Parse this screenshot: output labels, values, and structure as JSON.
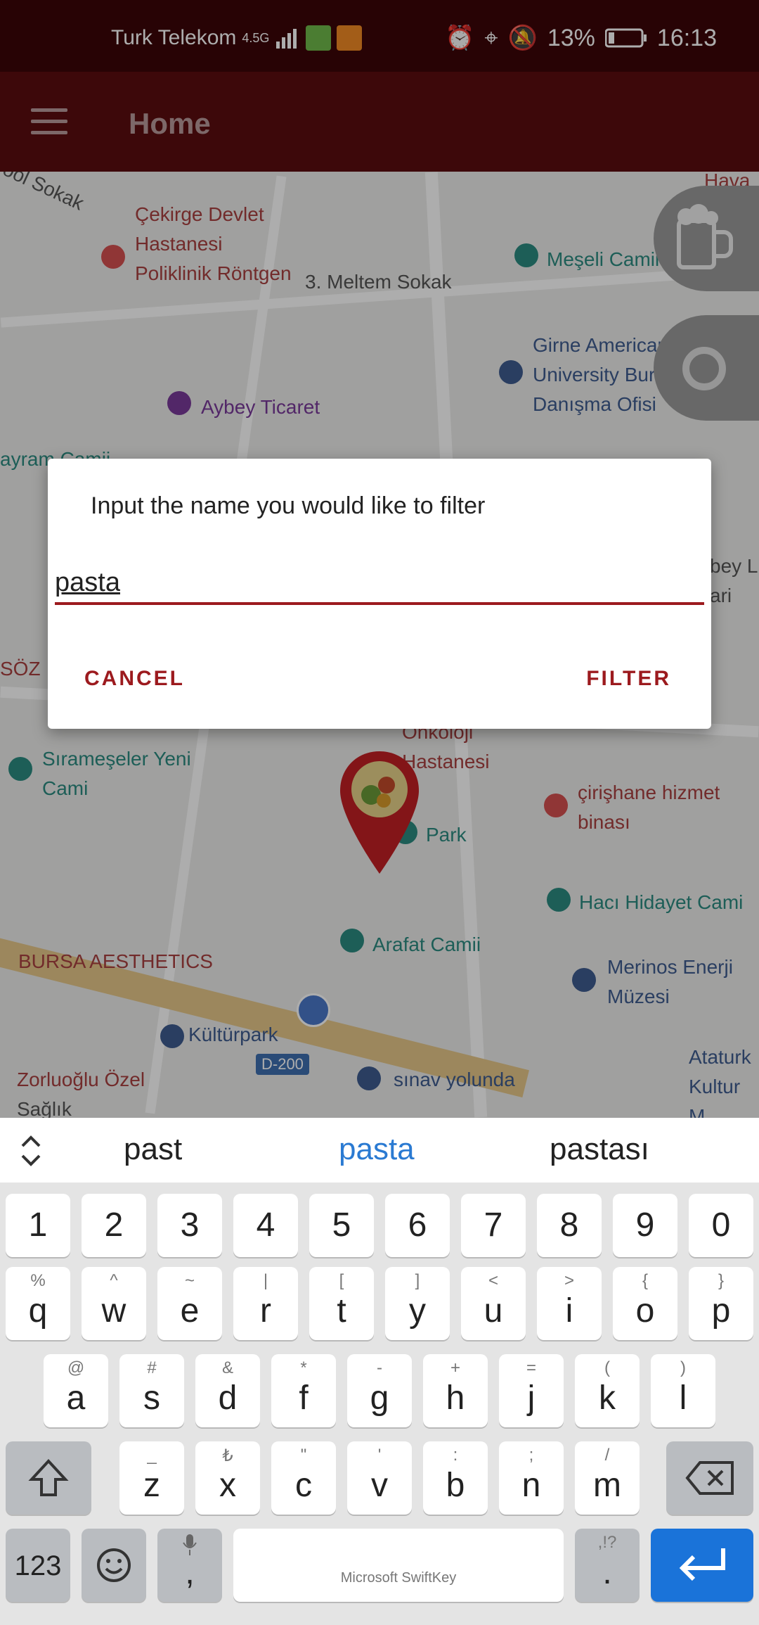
{
  "status_bar": {
    "carrier": "Turk Telekom",
    "network": "4.5G",
    "battery": "13%",
    "time": "16:13"
  },
  "app_bar": {
    "title": "Home"
  },
  "map": {
    "labels": [
      "Çekirge Devlet Hastanesi Poliklinik Röntgen",
      "3. Meltem Sokak",
      "Meşeli Camii",
      "Girne American University Bursa Danışma Ofisi",
      "Aybey Ticaret",
      "Sırameşeler Yeni Cami",
      "Onkoloji Hastanesi",
      "Park",
      "çirişhane hizmet binası",
      "Hacı Hidayet Cami",
      "Arafat Camii",
      "BURSA AESTHETICS",
      "Merinos Enerji Müzesi",
      "Kültürpark",
      "D-200",
      "Zorluoğlu Özel",
      "sınav yolunda",
      "Ataturk Kultur M",
      "Hava",
      "ool Sokak",
      "ayram Camii",
      "SÖZ",
      "bey L ari",
      "Sağlık"
    ]
  },
  "dialog": {
    "title": "Input the name you would like to filter",
    "input_value": "pasta",
    "cancel_label": "CANCEL",
    "filter_label": "FILTER"
  },
  "keyboard": {
    "suggestions": [
      "past",
      "pasta",
      "pastası"
    ],
    "row_numbers": [
      "1",
      "2",
      "3",
      "4",
      "5",
      "6",
      "7",
      "8",
      "9",
      "0"
    ],
    "row1": [
      {
        "main": "q",
        "sec": "%"
      },
      {
        "main": "w",
        "sec": "^"
      },
      {
        "main": "e",
        "sec": "~"
      },
      {
        "main": "r",
        "sec": "|"
      },
      {
        "main": "t",
        "sec": "["
      },
      {
        "main": "y",
        "sec": "]"
      },
      {
        "main": "u",
        "sec": "<"
      },
      {
        "main": "i",
        "sec": ">"
      },
      {
        "main": "o",
        "sec": "{"
      },
      {
        "main": "p",
        "sec": "}"
      }
    ],
    "row2": [
      {
        "main": "a",
        "sec": "@"
      },
      {
        "main": "s",
        "sec": "#"
      },
      {
        "main": "d",
        "sec": "&"
      },
      {
        "main": "f",
        "sec": "*"
      },
      {
        "main": "g",
        "sec": "-"
      },
      {
        "main": "h",
        "sec": "+"
      },
      {
        "main": "j",
        "sec": "="
      },
      {
        "main": "k",
        "sec": "("
      },
      {
        "main": "l",
        "sec": ")"
      }
    ],
    "row3": [
      {
        "main": "z",
        "sec": "_"
      },
      {
        "main": "x",
        "sec": "₺"
      },
      {
        "main": "c",
        "sec": "\""
      },
      {
        "main": "v",
        "sec": "'"
      },
      {
        "main": "b",
        "sec": ":"
      },
      {
        "main": "n",
        "sec": ";"
      },
      {
        "main": "m",
        "sec": "/"
      }
    ],
    "sym_label": "123",
    "comma": ",",
    "period": ".",
    "period_sec": ",!?",
    "space_label": "Microsoft SwiftKey"
  },
  "colors": {
    "accent": "#9c1a1e",
    "status_bar": "#3b0508",
    "app_bar": "#5a0d10",
    "enter_key": "#1a73d9",
    "suggestion_highlight": "#2a7ad2"
  }
}
